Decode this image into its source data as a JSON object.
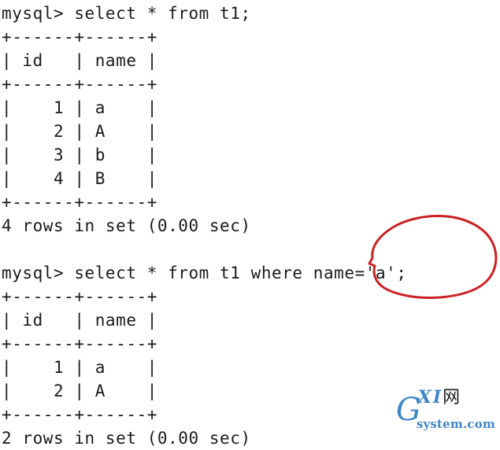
{
  "terminal": {
    "background_color": "#ffffff",
    "text_color": "#1a1a1a",
    "lines": [
      "mysql> select * from t1;",
      "+------+------+",
      "| id   | name |",
      "+------+------+",
      "|    1 | a    |",
      "|    2 | A    |",
      "|    3 | b    |",
      "|    4 | B    |",
      "+------+------+",
      "4 rows in set (0.00 sec)",
      "",
      "mysql> select * from t1 where name='a';",
      "+------+------+",
      "| id   | name |",
      "+------+------+",
      "|    1 | a    |",
      "|    2 | A    |",
      "+------+------+",
      "2 rows in set (0.00 sec)"
    ],
    "blocks": [
      {
        "prompt": "mysql>",
        "query": "select * from t1;",
        "columns": [
          "id",
          "name"
        ],
        "rows": [
          [
            "1",
            "a"
          ],
          [
            "2",
            "A"
          ],
          [
            "3",
            "b"
          ],
          [
            "4",
            "B"
          ]
        ],
        "status": "4 rows in set (0.00 sec)"
      },
      {
        "prompt": "mysql>",
        "query": "select * from t1 where name='a';",
        "columns": [
          "id",
          "name"
        ],
        "rows": [
          [
            "1",
            "a"
          ],
          [
            "2",
            "A"
          ]
        ],
        "status": "2 rows in set (0.00 sec)"
      }
    ]
  },
  "annotation": {
    "kind": "hand-drawn-ellipse",
    "color": "#cc2222",
    "stroke_width": 3,
    "highlights_text": "name='a';"
  },
  "watermark": {
    "logo_letter": "G",
    "logo_mid": "XI",
    "logo_cjk": "网",
    "domain": "system.com",
    "brand_color": "#3f86c8",
    "cjk_color": "#1a1a1a"
  }
}
